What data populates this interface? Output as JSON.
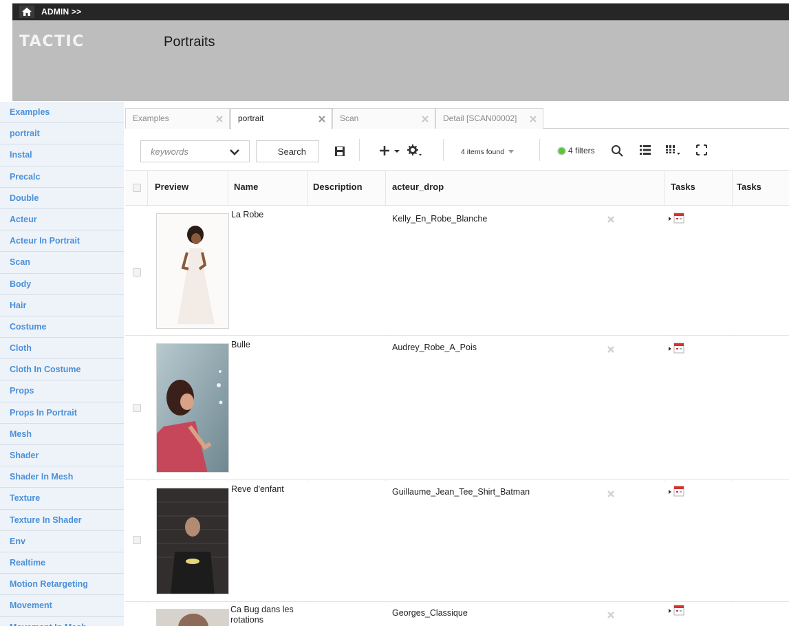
{
  "admin_bar": {
    "label": "ADMIN >>"
  },
  "header": {
    "logo": "TACTIC",
    "title": "Portraits"
  },
  "sidebar": {
    "items": [
      "Examples",
      "portrait",
      "Instal",
      "Precalc",
      "Double",
      "Acteur",
      "Acteur In Portrait",
      "Scan",
      "Body",
      "Hair",
      "Costume",
      "Cloth",
      "Cloth In Costume",
      "Props",
      "Props In Portrait",
      "Mesh",
      "Shader",
      "Shader In Mesh",
      "Texture",
      "Texture In Shader",
      "Env",
      "Realtime",
      "Motion Retargeting",
      "Movement",
      "Movement In Mesh"
    ]
  },
  "tabs": [
    "Examples",
    "portrait",
    "Scan",
    "Detail [SCAN00002]"
  ],
  "active_tab": "portrait",
  "toolbar": {
    "search_placeholder": "keywords",
    "search_label": "Search",
    "items_found": "4 items found",
    "filters_label": "4 filters"
  },
  "table": {
    "columns": [
      "Preview",
      "Name",
      "Description",
      "acteur_drop",
      "Tasks",
      "Tasks"
    ],
    "rows": [
      {
        "name": "La Robe",
        "description": "",
        "acteur_drop": "Kelly_En_Robe_Blanche"
      },
      {
        "name": "Bulle",
        "description": "",
        "acteur_drop": "Audrey_Robe_A_Pois"
      },
      {
        "name": "Reve d'enfant",
        "description": "",
        "acteur_drop": "Guillaume_Jean_Tee_Shirt_Batman"
      },
      {
        "name": "Ca Bug dans les rotations",
        "description": "",
        "acteur_drop": "Georges_Classique"
      }
    ]
  },
  "colors": {
    "sidebar_text": "#4a90d9",
    "header_bg": "#bdbdbd",
    "admin_bg": "#262626",
    "status_green": "#5cc63b"
  }
}
